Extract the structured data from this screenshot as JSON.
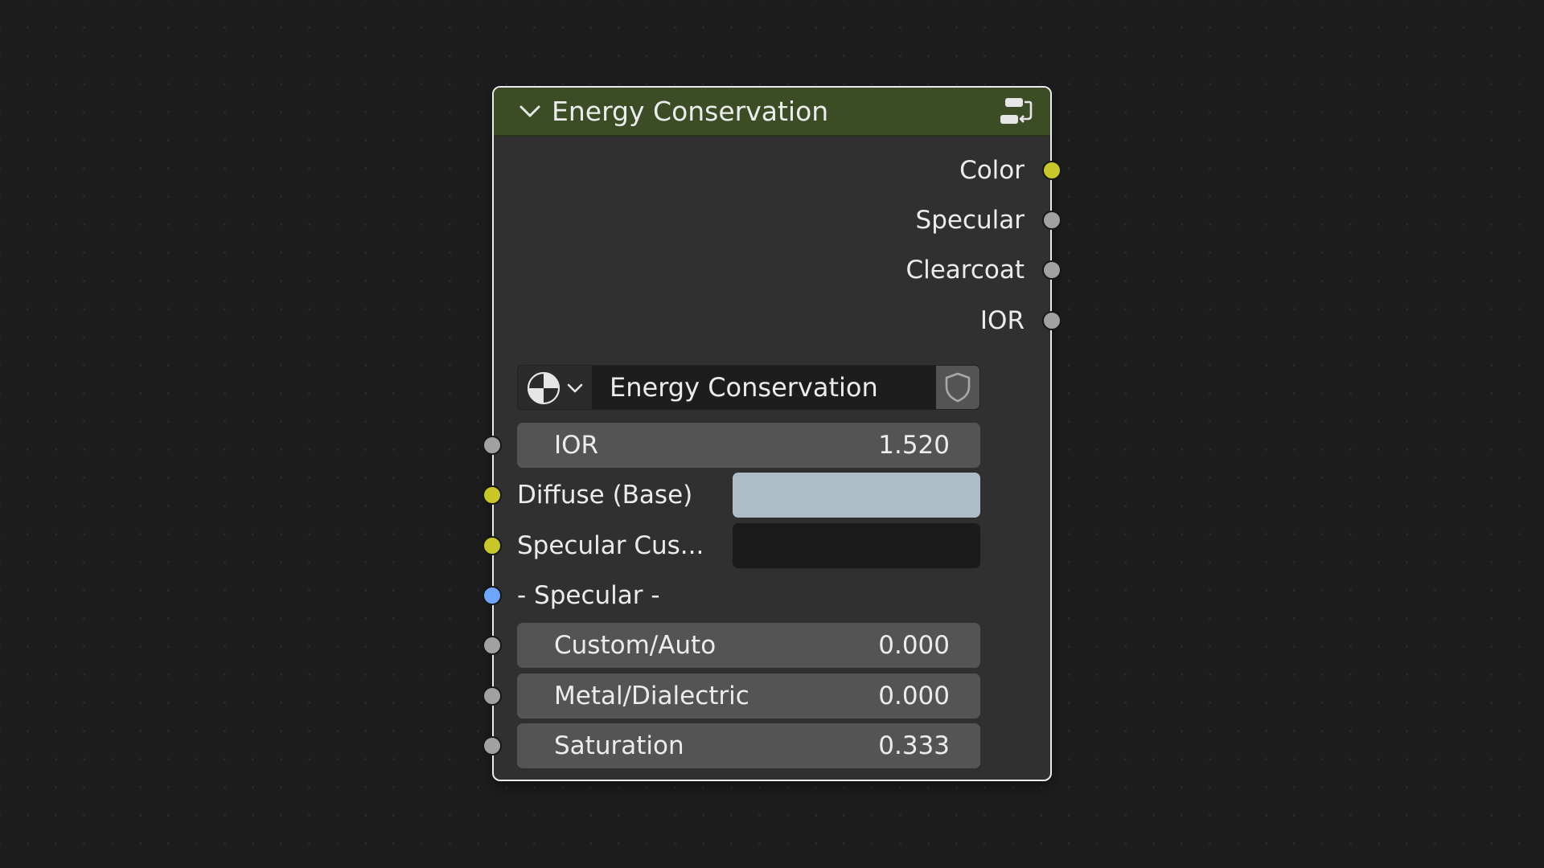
{
  "node": {
    "title": "Energy Conservation",
    "header_color": "#3c4d26",
    "outputs": [
      {
        "label": "Color",
        "socket_color": "#c7c729"
      },
      {
        "label": "Specular",
        "socket_color": "#a1a1a1"
      },
      {
        "label": "Clearcoat",
        "socket_color": "#a1a1a1"
      },
      {
        "label": "IOR",
        "socket_color": "#a1a1a1"
      }
    ],
    "datablock": {
      "name": "Energy Conservation",
      "type_icon": "node-tree-icon",
      "fake_user_icon": "shield-icon"
    },
    "inputs": {
      "ior": {
        "label": "IOR",
        "value": "1.520"
      },
      "diffuse": {
        "label": "Diffuse (Base)",
        "color": "#adbdc8"
      },
      "specular_custom": {
        "label": "Specular Cus...",
        "color": "#1a1a1a"
      },
      "specular_panel": {
        "label": "- Specular -"
      },
      "custom_auto": {
        "label": "Custom/Auto",
        "value": "0.000"
      },
      "metal_dialectric": {
        "label": "Metal/Dialectric",
        "value": "0.000"
      },
      "saturation": {
        "label": "Saturation",
        "value": "0.333"
      }
    }
  }
}
